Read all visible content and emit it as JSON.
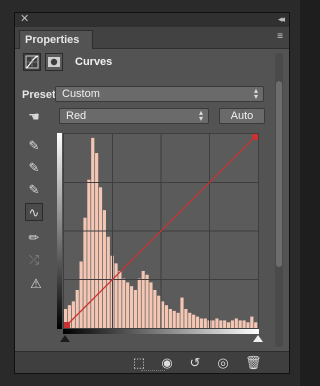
{
  "window": {
    "close_glyph": "✕",
    "collapse_glyph": "◂◂"
  },
  "tab": {
    "title": "Properties",
    "menu_glyph": "≡"
  },
  "header": {
    "title": "Curves",
    "adjustment_icon": "curves-icon",
    "mask_icon": "mask-icon"
  },
  "preset": {
    "label": "Preset:",
    "value": "Custom"
  },
  "channel": {
    "value": "Red",
    "auto_label": "Auto"
  },
  "tools": [
    {
      "name": "on-image-adjust-tool-icon",
      "glyph": "☚"
    },
    {
      "name": "black-point-eyedropper-icon",
      "glyph": "✎"
    },
    {
      "name": "gray-point-eyedropper-icon",
      "glyph": "✎"
    },
    {
      "name": "white-point-eyedropper-icon",
      "glyph": "✎"
    },
    {
      "name": "edit-curve-points-icon",
      "glyph": "∿"
    },
    {
      "name": "draw-curve-pencil-icon",
      "glyph": "✏"
    },
    {
      "name": "smooth-curve-icon",
      "glyph": "⤮"
    },
    {
      "name": "clipping-warning-icon",
      "glyph": "⚠"
    }
  ],
  "curve": {
    "channel_color": "#c83232",
    "histogram_color": "#f4c6b4",
    "control_points": [
      [
        0,
        0
      ],
      [
        255,
        255
      ]
    ],
    "histogram": [
      0.1,
      0.12,
      0.14,
      0.2,
      0.35,
      0.58,
      0.78,
      1.0,
      0.92,
      0.74,
      0.62,
      0.48,
      0.38,
      0.34,
      0.3,
      0.26,
      0.24,
      0.22,
      0.2,
      0.26,
      0.3,
      0.28,
      0.24,
      0.2,
      0.17,
      0.14,
      0.12,
      0.1,
      0.09,
      0.08,
      0.16,
      0.1,
      0.08,
      0.07,
      0.06,
      0.05,
      0.05,
      0.04,
      0.04,
      0.05,
      0.04,
      0.04,
      0.03,
      0.04,
      0.05,
      0.04,
      0.04,
      0.03,
      0.06,
      0.03
    ]
  },
  "footer": {
    "icons": [
      "clip-to-layer-icon",
      "view-previous-state-icon",
      "reset-icon",
      "visibility-icon",
      "delete-icon"
    ],
    "glyphs": [
      "⬚",
      "◉",
      "↺",
      "◎",
      "🗑"
    ]
  }
}
